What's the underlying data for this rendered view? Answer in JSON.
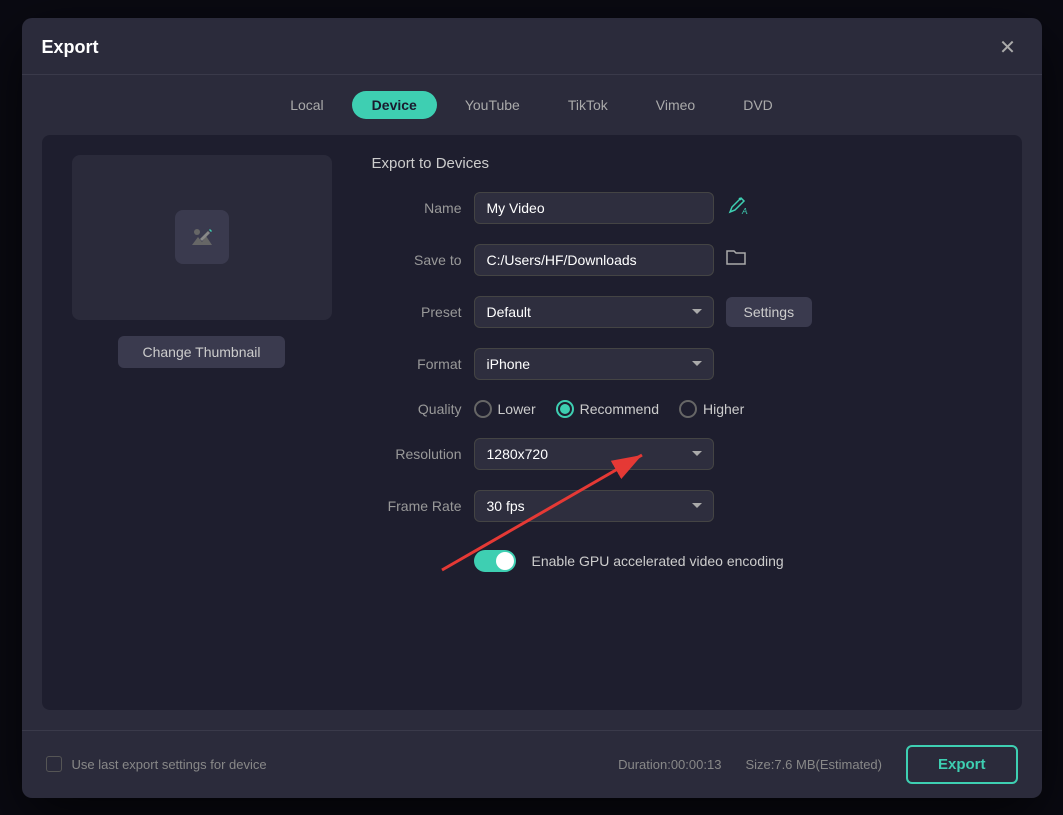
{
  "dialog": {
    "title": "Export",
    "close_label": "✕"
  },
  "tabs": [
    {
      "id": "local",
      "label": "Local",
      "active": false
    },
    {
      "id": "device",
      "label": "Device",
      "active": true
    },
    {
      "id": "youtube",
      "label": "YouTube",
      "active": false
    },
    {
      "id": "tiktok",
      "label": "TikTok",
      "active": false
    },
    {
      "id": "vimeo",
      "label": "Vimeo",
      "active": false
    },
    {
      "id": "dvd",
      "label": "DVD",
      "active": false
    }
  ],
  "left_panel": {
    "change_thumbnail_label": "Change Thumbnail"
  },
  "form": {
    "section_title": "Export to Devices",
    "name_label": "Name",
    "name_value": "My Video",
    "save_to_label": "Save to",
    "save_to_value": "C:/Users/HF/Downloads",
    "preset_label": "Preset",
    "preset_value": "Default",
    "settings_label": "Settings",
    "format_label": "Format",
    "format_value": "iPhone",
    "quality_label": "Quality",
    "quality_options": [
      {
        "id": "lower",
        "label": "Lower",
        "checked": false
      },
      {
        "id": "recommend",
        "label": "Recommend",
        "checked": true
      },
      {
        "id": "higher",
        "label": "Higher",
        "checked": false
      }
    ],
    "resolution_label": "Resolution",
    "resolution_value": "1280x720",
    "frame_rate_label": "Frame Rate",
    "frame_rate_value": "30 fps",
    "gpu_label": "Enable GPU accelerated video encoding"
  },
  "bottom": {
    "use_last_label": "Use last export settings for device",
    "duration_label": "Duration:00:00:13",
    "size_label": "Size:7.6 MB(Estimated)",
    "export_label": "Export"
  }
}
